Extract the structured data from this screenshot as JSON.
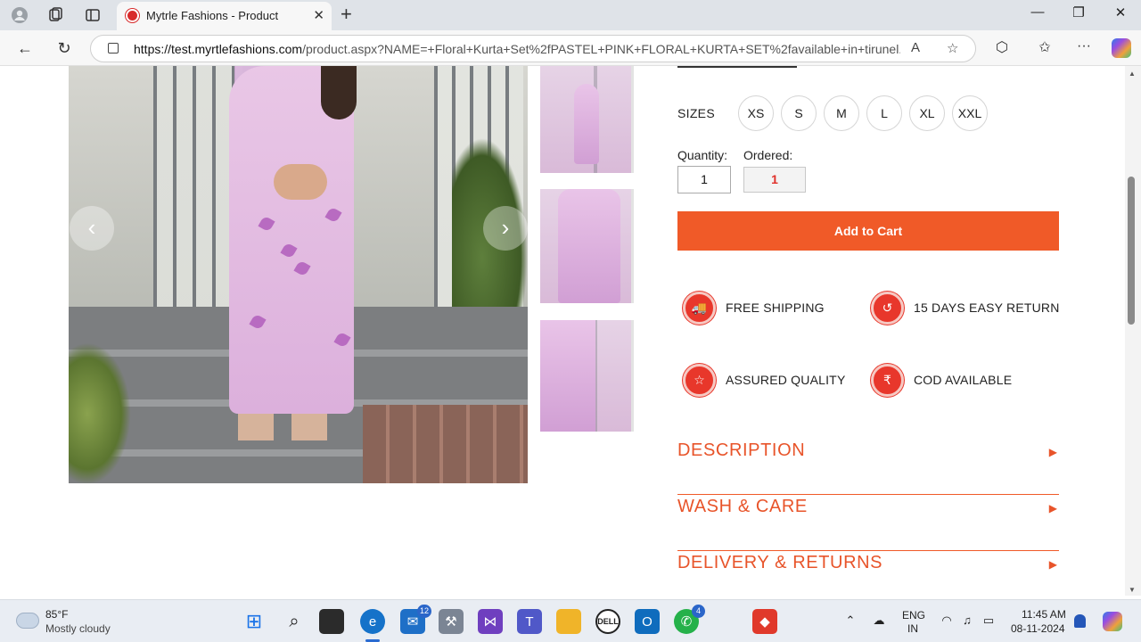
{
  "browser": {
    "tab_title": "Mytrle Fashions - Product",
    "url_host": "https://test.myrtlefashions.com",
    "url_rest": "/product.aspx?NAME=+Floral+Kurta+Set%2fPASTEL+PINK+FLORAL+KURTA+SET%2favailable+in+tirunel..."
  },
  "product": {
    "sizes_label": "SIZES",
    "sizes": [
      "XS",
      "S",
      "M",
      "L",
      "XL",
      "XXL"
    ],
    "quantity_label": "Quantity:",
    "quantity_value": "1",
    "ordered_label": "Ordered:",
    "ordered_value": "1",
    "add_to_cart": "Add to Cart",
    "features": [
      "FREE SHIPPING",
      "15 DAYS EASY RETURN",
      "ASSURED QUALITY",
      "COD AVAILABLE"
    ],
    "accordions": [
      "DESCRIPTION",
      "WASH & CARE",
      "DELIVERY & RETURNS"
    ]
  },
  "taskbar": {
    "weather_temp": "85°F",
    "weather_cond": "Mostly cloudy",
    "mail_badge": "12",
    "whatsapp_badge": "4",
    "lang_line1": "ENG",
    "lang_line2": "IN",
    "time": "11:45 AM",
    "date": "08-11-2024"
  },
  "colors": {
    "accent": "#f05a28",
    "feature_icon": "#e8372b",
    "ordered_value": "#e0302a"
  }
}
